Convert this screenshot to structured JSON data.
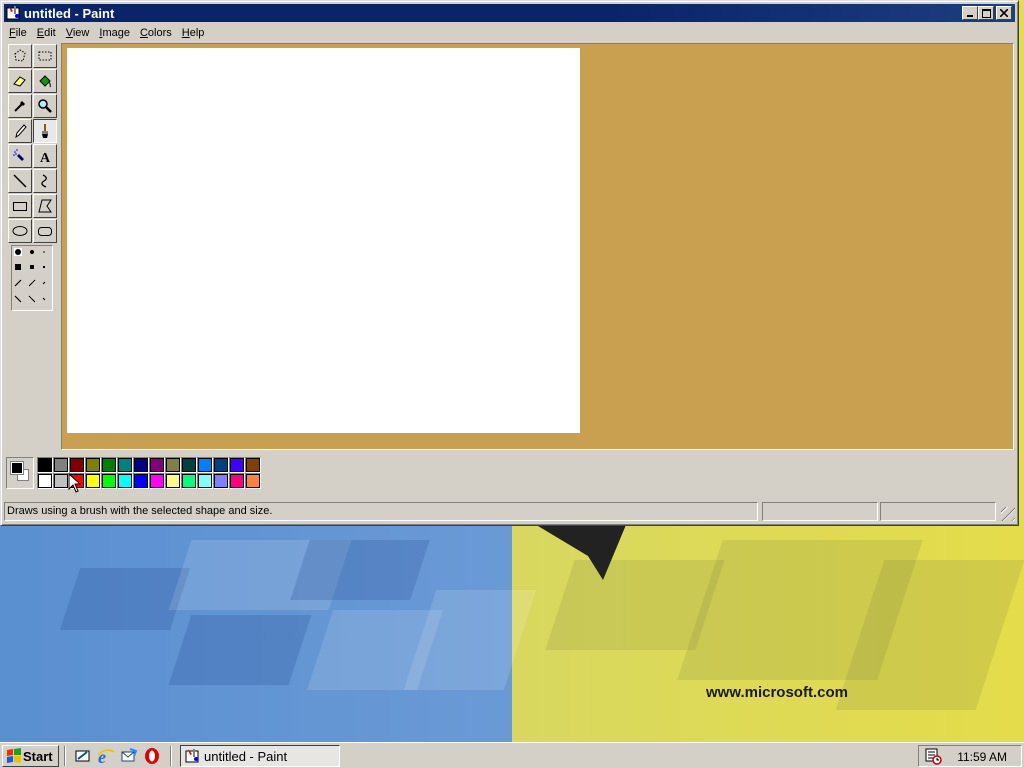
{
  "window": {
    "title": "untitled - Paint",
    "minimize_icon": "minimize-icon",
    "maximize_icon": "maximize-icon",
    "close_icon": "close-icon"
  },
  "menu": [
    "File",
    "Edit",
    "View",
    "Image",
    "Colors",
    "Help"
  ],
  "tools": [
    {
      "name": "free-form-select",
      "icon": "free-form-select-icon"
    },
    {
      "name": "select",
      "icon": "select-icon"
    },
    {
      "name": "eraser",
      "icon": "eraser-icon"
    },
    {
      "name": "fill-with-color",
      "icon": "fill-bucket-icon"
    },
    {
      "name": "pick-color",
      "icon": "eyedropper-icon"
    },
    {
      "name": "magnifier",
      "icon": "magnifier-icon"
    },
    {
      "name": "pencil",
      "icon": "pencil-icon"
    },
    {
      "name": "brush",
      "icon": "brush-icon",
      "active": true
    },
    {
      "name": "airbrush",
      "icon": "airbrush-icon"
    },
    {
      "name": "text",
      "icon": "text-icon"
    },
    {
      "name": "line",
      "icon": "line-icon"
    },
    {
      "name": "curve",
      "icon": "curve-icon"
    },
    {
      "name": "rectangle",
      "icon": "rectangle-icon"
    },
    {
      "name": "polygon",
      "icon": "polygon-icon"
    },
    {
      "name": "ellipse",
      "icon": "ellipse-icon"
    },
    {
      "name": "rounded-rectangle",
      "icon": "rounded-rectangle-icon"
    }
  ],
  "colors": {
    "foreground": "#000000",
    "background": "#ffffff",
    "canvas_background": "#c8a050",
    "palette_row1": [
      "#000000",
      "#808080",
      "#800000",
      "#808000",
      "#008000",
      "#008080",
      "#000080",
      "#800080",
      "#808040",
      "#004040",
      "#0080ff",
      "#004080",
      "#4000ff",
      "#804000"
    ],
    "palette_row2": [
      "#ffffff",
      "#c0c0c0",
      "#ff0000",
      "#ffff00",
      "#00ff00",
      "#00ffff",
      "#0000ff",
      "#ff00ff",
      "#ffff80",
      "#00ff80",
      "#80ffff",
      "#8080ff",
      "#ff0080",
      "#ff8040"
    ]
  },
  "status": {
    "text": "Draws using a brush with the selected shape and size.",
    "coordinates": "",
    "size": ""
  },
  "taskbar": {
    "start_label": "Start",
    "quick_launch": [
      "show-desktop-icon",
      "internet-explorer-icon",
      "outlook-express-icon",
      "opera-icon"
    ],
    "task_label": "untitled - Paint",
    "clock": "11:59 AM",
    "tray_icon": "scheduled-tasks-icon"
  },
  "wallpaper": {
    "url_text": "www.microsoft.com"
  }
}
